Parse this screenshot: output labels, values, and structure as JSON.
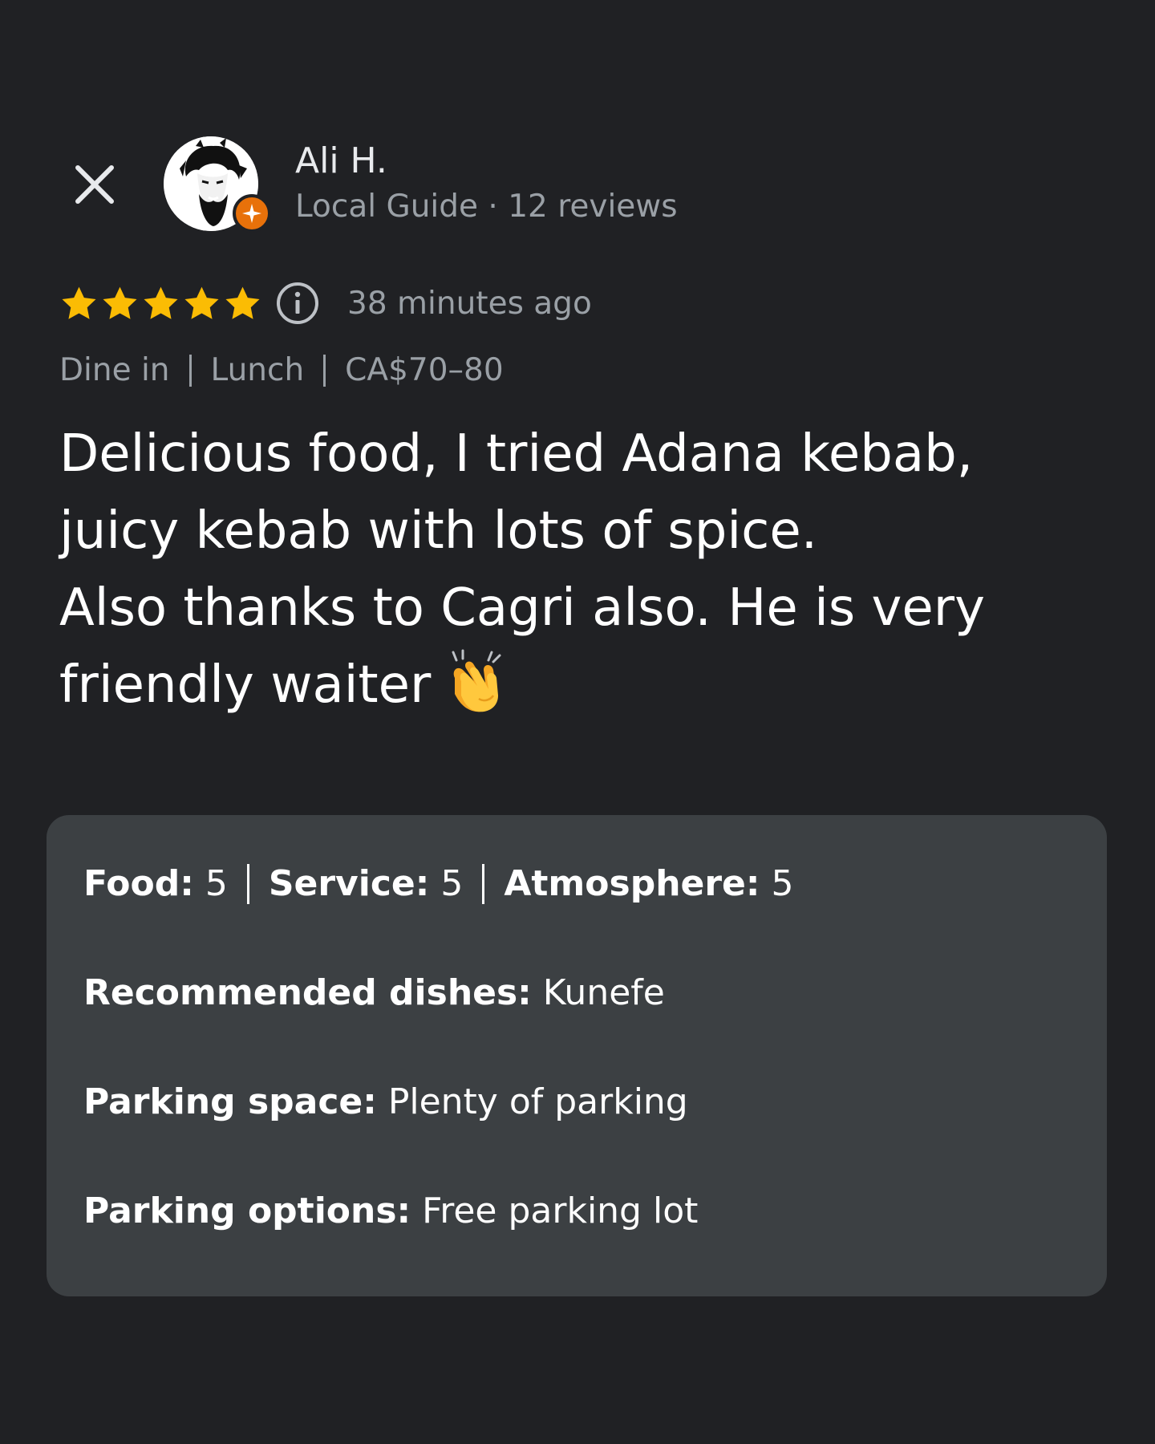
{
  "reviewer": {
    "name": "Ali H.",
    "meta": "Local Guide · 12 reviews"
  },
  "rating": {
    "stars": 5,
    "time_ago": "38 minutes ago",
    "star_color": "#fbbc04"
  },
  "visit": {
    "service": "Dine in",
    "meal": "Lunch",
    "price": "CA$70–80"
  },
  "review": {
    "lines": [
      "Delicious food, I tried Adana kebab,",
      "juicy kebab with lots of spice.",
      "Also thanks to Cagri also. He is very",
      "friendly waiter"
    ],
    "emoji": "clapping-hands"
  },
  "details": {
    "food_label": "Food:",
    "food_value": "5",
    "service_label": "Service:",
    "service_value": "5",
    "atmosphere_label": "Atmosphere:",
    "atmosphere_value": "5",
    "dishes_label": "Recommended dishes:",
    "dishes_value": "Kunefe",
    "parking_space_label": "Parking space:",
    "parking_space_value": "Plenty of parking",
    "parking_options_label": "Parking options:",
    "parking_options_value": "Free parking lot"
  },
  "colors": {
    "background": "#202124",
    "card": "#3c4043",
    "badge": "#e8710a",
    "secondary_text": "#9aa0a6"
  }
}
